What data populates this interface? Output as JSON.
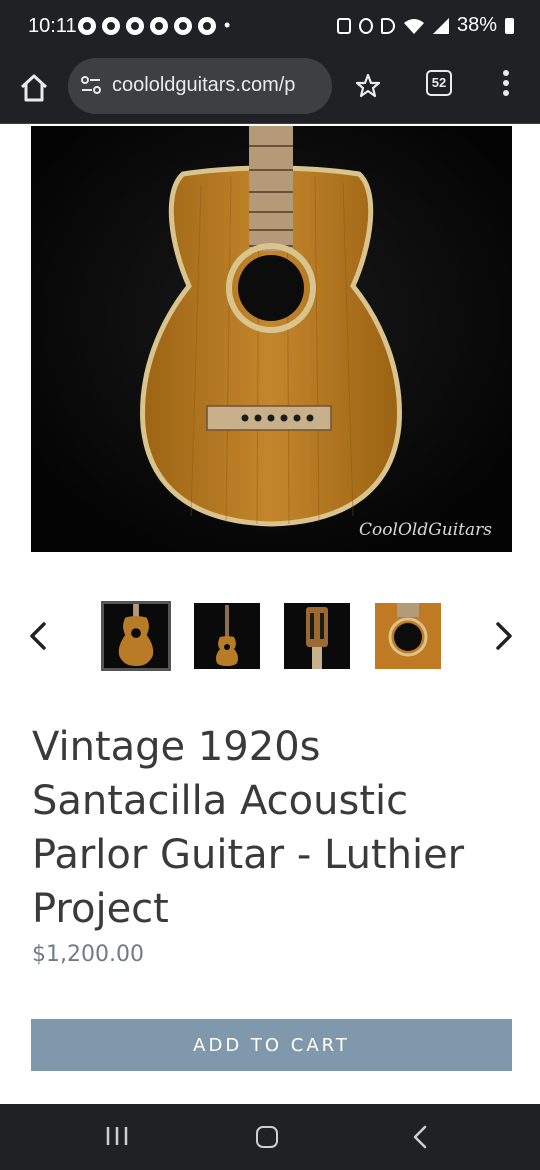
{
  "status_bar": {
    "time": "10:11",
    "battery": "38%"
  },
  "browser": {
    "url": "coololdguitars.com/p",
    "tab_count": "52"
  },
  "product": {
    "image_watermark": "CoolOldGuitars",
    "title": "Vintage 1920s Santacilla Acoustic Parlor Guitar - Luthier Project",
    "price": "$1,200.00",
    "add_to_cart_label": "ADD TO CART"
  },
  "gallery": {
    "thumbnails": [
      "guitar-front",
      "guitar-full",
      "guitar-headstock",
      "guitar-soundhole"
    ],
    "active_index": 0
  },
  "colors": {
    "accent_button": "#7f98ab",
    "price_text": "#6f7c86",
    "title_text": "#3a3a3a",
    "system_bar": "#202124"
  }
}
